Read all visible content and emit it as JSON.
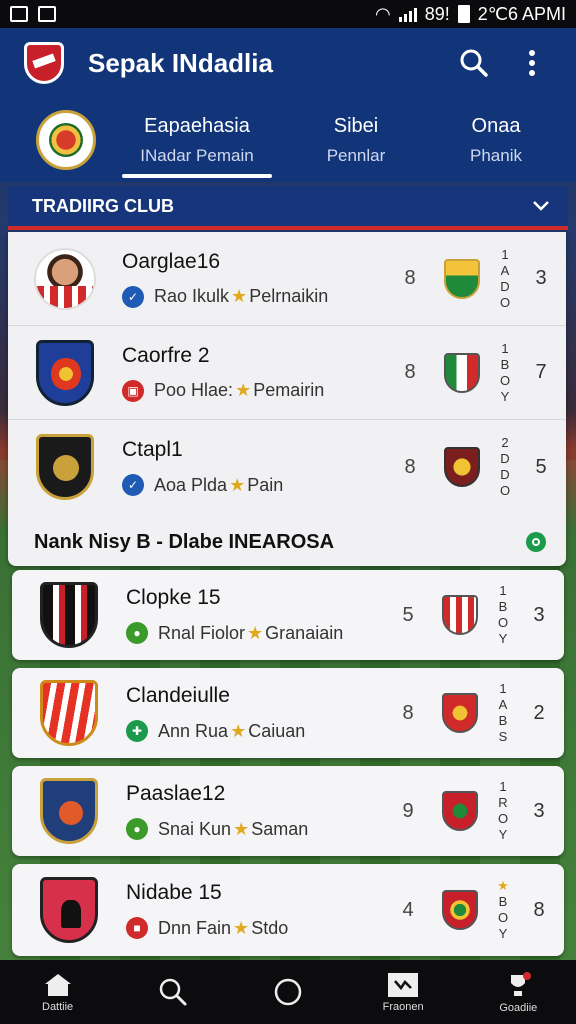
{
  "status": {
    "time": "2℃6 APMI",
    "battery": "89!"
  },
  "app": {
    "title": "Sepak INdadlia"
  },
  "tabs": [
    {
      "line1": "Eapaehasia",
      "line2": "INadar Pemain"
    },
    {
      "line1": "Sibei",
      "line2": "Pennlar"
    },
    {
      "line1": "Onaa",
      "line2": "Phanik"
    }
  ],
  "section": {
    "title": "TRADIIRG CLUB"
  },
  "top_rows": [
    {
      "name": "Oarglae16",
      "sub_a": "Rao Ikulk",
      "sub_b": "Pelrnaikin",
      "num": "8",
      "vert": [
        "1",
        "A",
        "D",
        "O"
      ],
      "right": "3",
      "badge_color": "#1f5bb5"
    },
    {
      "name": "Caorfre 2",
      "sub_a": "Poo Hlae:",
      "sub_b": "Pemairin",
      "num": "8",
      "vert": [
        "1",
        "B",
        "O",
        "Y"
      ],
      "right": "7",
      "badge_color": "#d02a2a"
    },
    {
      "name": "Ctapl1",
      "sub_a": "Aoa Plda",
      "sub_b": "Pain",
      "num": "8",
      "vert": [
        "2",
        "D",
        "D",
        "O"
      ],
      "right": "5",
      "badge_color": "#1f5bb5"
    }
  ],
  "group": {
    "title": "Nank Nisy B - Dlabe INEAROSA"
  },
  "cards": [
    {
      "name": "Clopke 15",
      "sub_a": "Rnal Fiolor",
      "sub_b": "Granaiain",
      "num": "5",
      "vert": [
        "1",
        "B",
        "O",
        "Y"
      ],
      "right": "3",
      "badge_color": "#3a9a2a"
    },
    {
      "name": "Clandeiulle",
      "sub_a": "Ann Rua",
      "sub_b": "Caiuan",
      "num": "8",
      "vert": [
        "1",
        "A",
        "B",
        "S"
      ],
      "right": "2",
      "badge_color": "#1a9a4a"
    },
    {
      "name": "Paaslae12",
      "sub_a": "Snai Kun",
      "sub_b": "Saman",
      "num": "9",
      "vert": [
        "1",
        "R",
        "O",
        "Y"
      ],
      "right": "3",
      "badge_color": "#3a9a2a"
    },
    {
      "name": "Nidabe 15",
      "sub_a": "Dnn Fain",
      "sub_b": "Stdo",
      "num": "4",
      "vert": [
        "★",
        "B",
        "O",
        "Y"
      ],
      "right": "8",
      "badge_color": "#d02a2a"
    }
  ],
  "nav": [
    {
      "label": "Dattiie",
      "icon": "home-icon"
    },
    {
      "label": "",
      "icon": "search-icon"
    },
    {
      "label": "",
      "icon": "circle-icon"
    },
    {
      "label": "Fraonen",
      "icon": "scoreboard-icon"
    },
    {
      "label": "Goadiie",
      "icon": "trophy-icon"
    }
  ],
  "colors": {
    "header": "#12357a",
    "accent_red": "#d02a2a",
    "star": "#e0a91e"
  }
}
